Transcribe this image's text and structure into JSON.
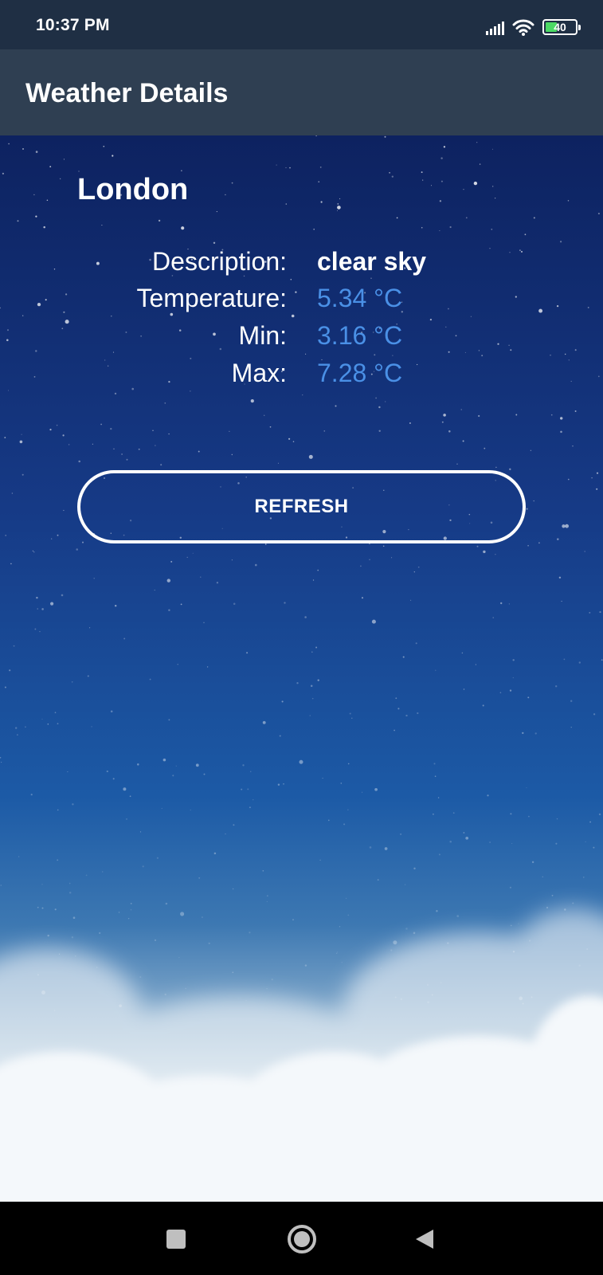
{
  "status_bar": {
    "time": "10:37 PM",
    "battery": "40",
    "icons": [
      "signal-icon",
      "wifi-icon",
      "battery-icon"
    ]
  },
  "app_bar": {
    "title": "Weather Details"
  },
  "weather": {
    "city": "London",
    "rows": [
      {
        "label": "Description:",
        "value": "clear sky"
      },
      {
        "label": "Temperature:",
        "value": "5.34 °C"
      },
      {
        "label": "Min:",
        "value": "3.16 °C"
      },
      {
        "label": "Max:",
        "value": "7.28 °C"
      }
    ],
    "refresh_label": "REFRESH"
  },
  "nav_bar": {
    "icons": [
      "recents-icon",
      "home-icon",
      "back-icon"
    ]
  },
  "colors": {
    "status_bar": "#1f2f44",
    "app_bar": "#2f3f52",
    "value_blue": "#4a90e6",
    "sky_top": "#0d2260"
  }
}
